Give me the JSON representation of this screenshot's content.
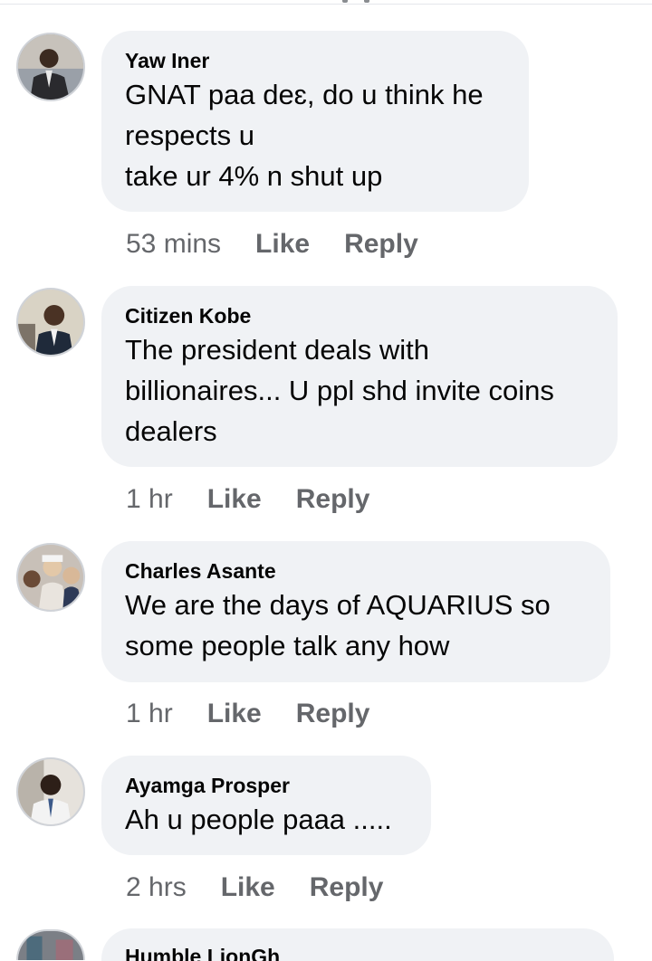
{
  "comments": [
    {
      "author": "Yaw Iner",
      "text": "GNAT paa deɛ, do u think he\nrespects u\ntake ur 4% n shut up",
      "time": "53 mins",
      "like": "Like",
      "reply": "Reply"
    },
    {
      "author": "Citizen Kobe",
      "text": "The president deals with\nbillionaires... U ppl shd invite coins\ndealers",
      "time": "1 hr",
      "like": "Like",
      "reply": "Reply"
    },
    {
      "author": "Charles Asante",
      "text": "We are the days of  AQUARIUS  so\nsome people talk any how",
      "time": "1 hr",
      "like": "Like",
      "reply": "Reply"
    },
    {
      "author": "Ayamga Prosper",
      "text": "Ah u people paaa .....",
      "time": "2 hrs",
      "like": "Like",
      "reply": "Reply"
    },
    {
      "author": "Humble LionGh",
      "text": ""
    }
  ],
  "colors": {
    "bubble": "#f0f2f5",
    "meta": "#65676b",
    "text": "#050505"
  }
}
